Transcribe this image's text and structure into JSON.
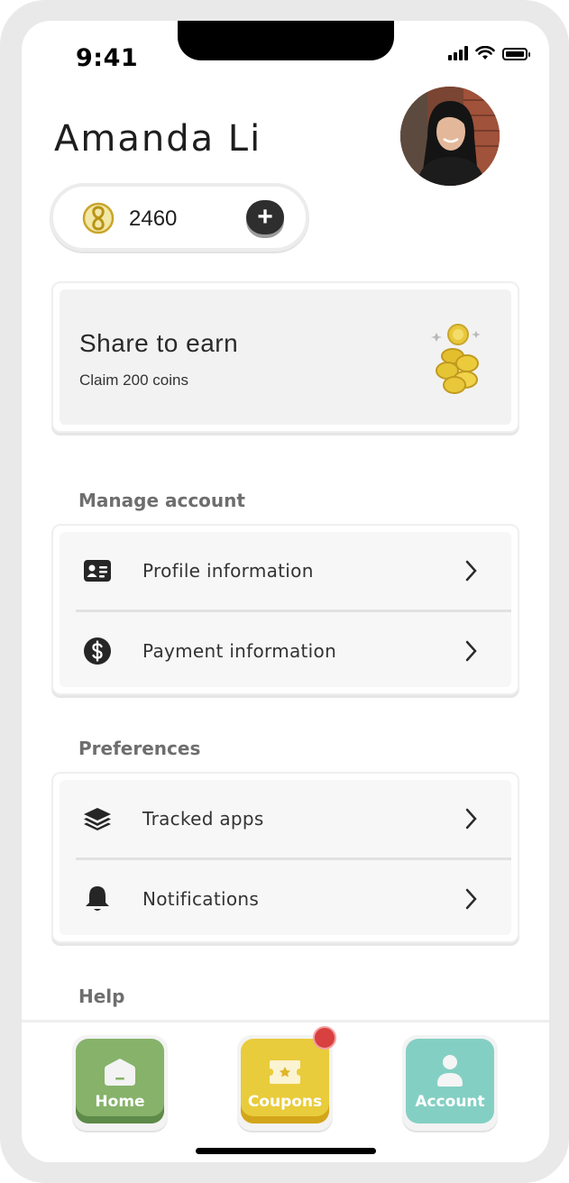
{
  "status_bar": {
    "time": "9:41",
    "icons": [
      "signal-icon",
      "wifi-icon",
      "battery-icon"
    ]
  },
  "profile": {
    "name": "Amanda Li",
    "avatar": "profile-photo"
  },
  "coins": {
    "count": "2460",
    "icon": "coin-icon",
    "add_icon": "plus-icon"
  },
  "share_card": {
    "title": "Share to earn",
    "subtitle": "Claim 200 coins",
    "illustration": "coins-stack-icon"
  },
  "sections": {
    "manage_account": {
      "title": "Manage account",
      "items": [
        {
          "label": "Profile information",
          "icon": "id-card-icon"
        },
        {
          "label": "Payment information",
          "icon": "dollar-circle-icon"
        }
      ]
    },
    "preferences": {
      "title": "Preferences",
      "items": [
        {
          "label": "Tracked apps",
          "icon": "layers-icon"
        },
        {
          "label": "Notifications",
          "icon": "bell-icon"
        }
      ]
    },
    "help": {
      "title": "Help"
    }
  },
  "tabbar": {
    "tabs": [
      {
        "label": "Home",
        "icon": "home-icon",
        "color": "#86b26a"
      },
      {
        "label": "Coupons",
        "icon": "ticket-icon",
        "color": "#e9cc3c",
        "badge": true
      },
      {
        "label": "Account",
        "icon": "user-icon",
        "color": "#84cfc3"
      }
    ]
  },
  "colors": {
    "accent_dark": "#2e2e2e",
    "coin_gold": "#d8b627",
    "badge_red": "#d94040"
  }
}
